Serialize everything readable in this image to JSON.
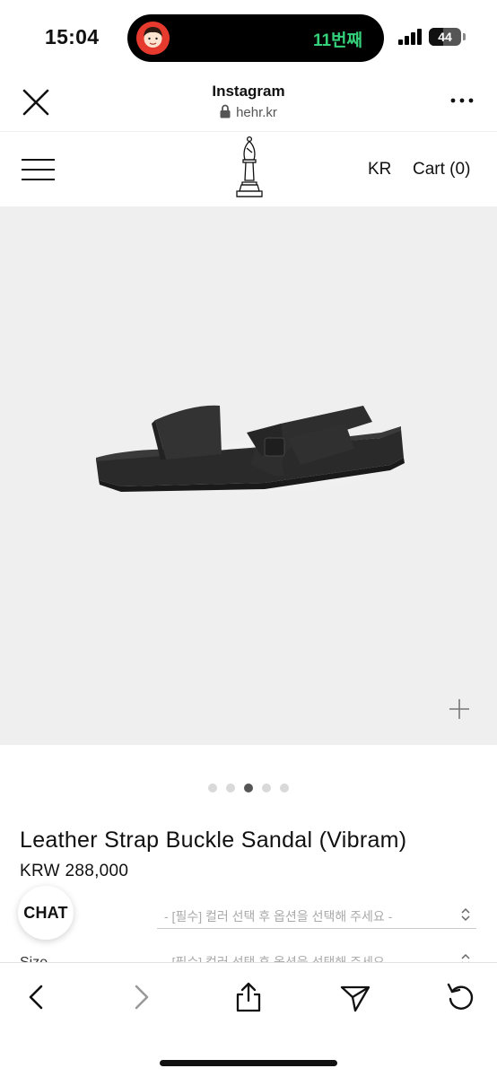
{
  "status_bar": {
    "time": "15:04",
    "island_text": "11번째",
    "battery": "44",
    "battery_level": 0.44
  },
  "browser": {
    "title": "Instagram",
    "url": "hehr.kr"
  },
  "site": {
    "nav_language": "KR",
    "nav_cart": "Cart (0)"
  },
  "gallery": {
    "dot_count": 5,
    "active_index": 2
  },
  "product": {
    "title": "Leather Strap Buckle Sandal (Vibram)",
    "price": "KRW 288,000",
    "options": [
      {
        "placeholder": "- [필수] 컬러 선택 후 옵션을 선택해 주세요 -"
      },
      {
        "placeholder": "- [필수] 컬러 선택 후 옵션을 선택해 주세요 -"
      }
    ],
    "size_label": "Size"
  },
  "chat": {
    "label": "CHAT"
  },
  "colors": {
    "background": "#ffffff",
    "product_bg": "#efefef",
    "island_text": "#35d17a"
  }
}
